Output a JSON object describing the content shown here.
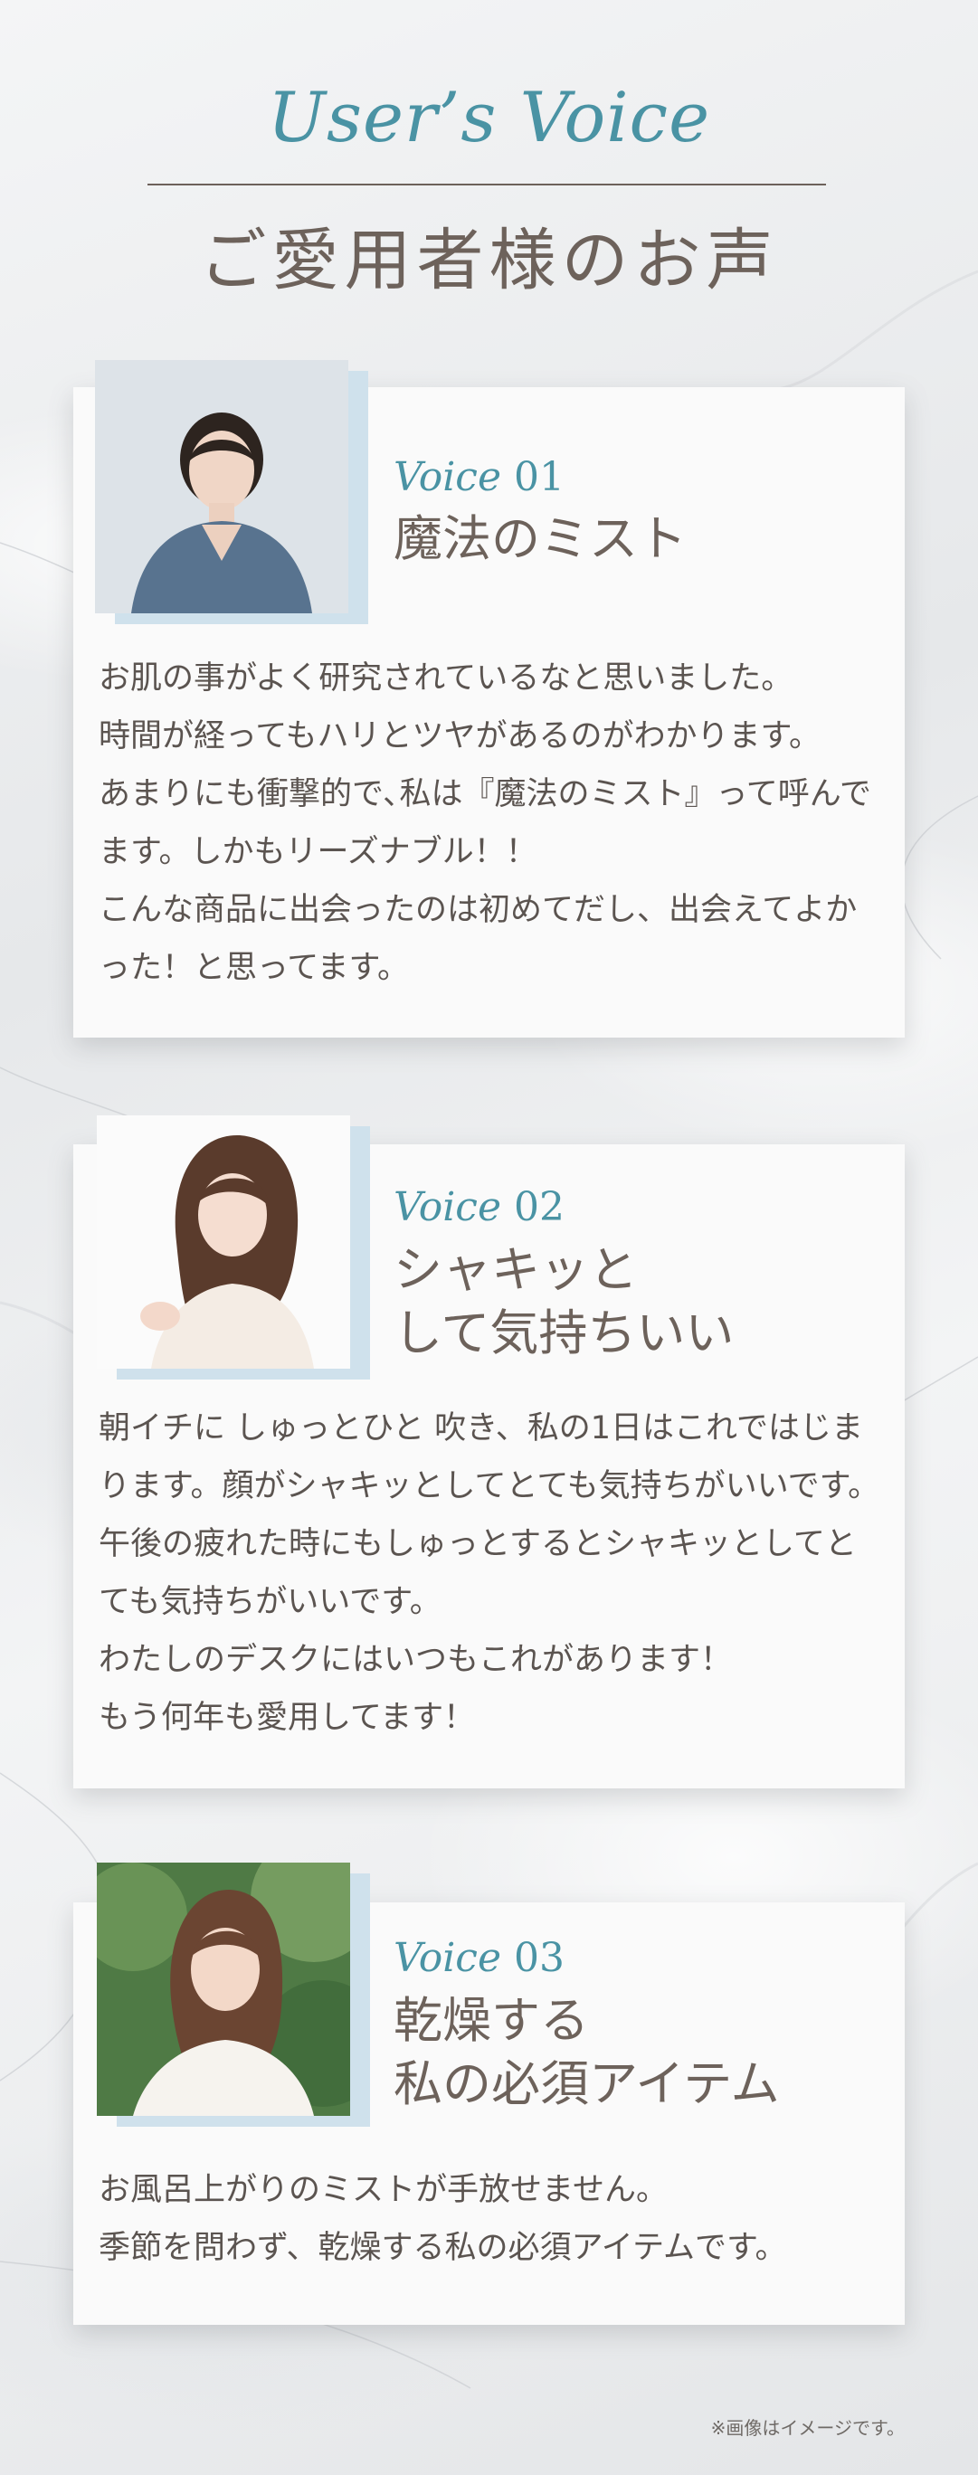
{
  "header": {
    "en_title": "User’s Voice",
    "jp_title": "ご愛用者様のお声"
  },
  "voices": [
    {
      "label_word": "Voice",
      "label_num": "01",
      "title": "魔法のミスト",
      "body": "お肌の事がよく研究されているなと思いました。\n時間が経ってもハリとツヤがあるのがわかります。\nあまりにも衝撃的で､私は『魔法のミスト』って呼んでます。しかもリーズナブル！！\nこんな商品に出会ったのは初めてだし、出会えてよかった！と思ってます。"
    },
    {
      "label_word": "Voice",
      "label_num": "02",
      "title": "シャキッと\nして気持ちいい",
      "body": "朝イチに しゅっとひと 吹き、私の1日はこれではじまります。顔がシャキッとしてとても気持ちがいいです。午後の疲れた時にもしゅっとするとシャキッとしてとても気持ちがいいです。\nわたしのデスクにはいつもこれがあります！\nもう何年も愛用してます！"
    },
    {
      "label_word": "Voice",
      "label_num": "03",
      "title": "乾燥する\n私の必須アイテム",
      "body": "お風呂上がりのミストが手放せません。\n季節を問わず、乾燥する私の必須アイテムです。"
    }
  ],
  "footnote": "※画像はイメージです。",
  "colors": {
    "accent_teal": "#4a93a4",
    "heading_brown": "#6d625b",
    "photo_accent": "#cfe1ec"
  }
}
